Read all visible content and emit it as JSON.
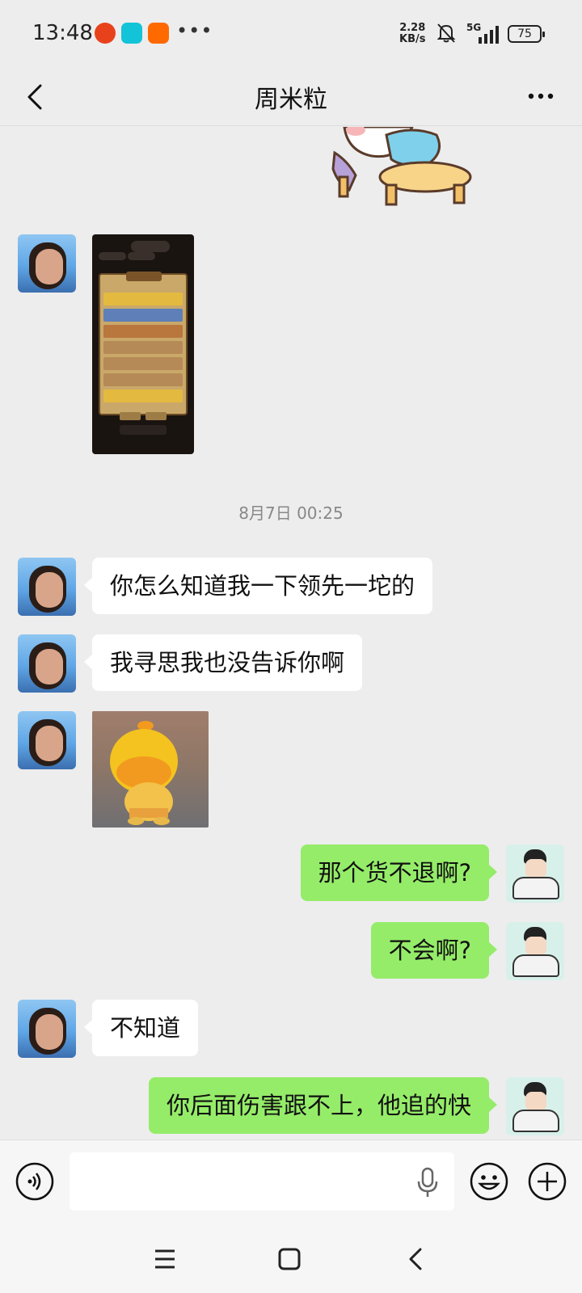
{
  "status_bar": {
    "time": "13:48",
    "net_speed_value": "2.28",
    "net_speed_unit": "KB/s",
    "network": "5G",
    "battery": "75",
    "icons": [
      "pinduoduo-app-icon",
      "taptap-app-icon",
      "taobao-app-icon",
      "more-notifications-icon",
      "mute-bell-icon",
      "signal-icon",
      "battery-icon"
    ]
  },
  "header": {
    "title": "周米粒",
    "back_icon": "chevron-left-icon",
    "more_icon": "more-dots-icon"
  },
  "chat": {
    "timestamp": "8月7日 00:25",
    "messages": [
      {
        "side": "left",
        "type": "image",
        "content": "game-leaderboard-screenshot"
      },
      {
        "side": "left",
        "type": "text",
        "text": "你怎么知道我一下领先一坨的"
      },
      {
        "side": "left",
        "type": "text",
        "text": "我寻思我也没告诉你啊"
      },
      {
        "side": "left",
        "type": "image",
        "content": "yellow-duck-sticker"
      },
      {
        "side": "right",
        "type": "text",
        "text": "那个货不退啊?"
      },
      {
        "side": "right",
        "type": "text",
        "text": "不会啊?"
      },
      {
        "side": "left",
        "type": "text",
        "text": "不知道"
      },
      {
        "side": "right",
        "type": "text",
        "text": "你后面伤害跟不上，他追的快"
      }
    ]
  },
  "input_bar": {
    "value": "",
    "icons": [
      "voice-icon",
      "microphone-icon",
      "emoji-icon",
      "plus-icon"
    ]
  },
  "nav_bar": {
    "icons": [
      "menu-icon",
      "home-icon",
      "back-icon"
    ]
  },
  "colors": {
    "background": "#ededed",
    "bubble_self": "#95ec69",
    "bubble_other": "#ffffff",
    "timestamp": "#888888"
  }
}
